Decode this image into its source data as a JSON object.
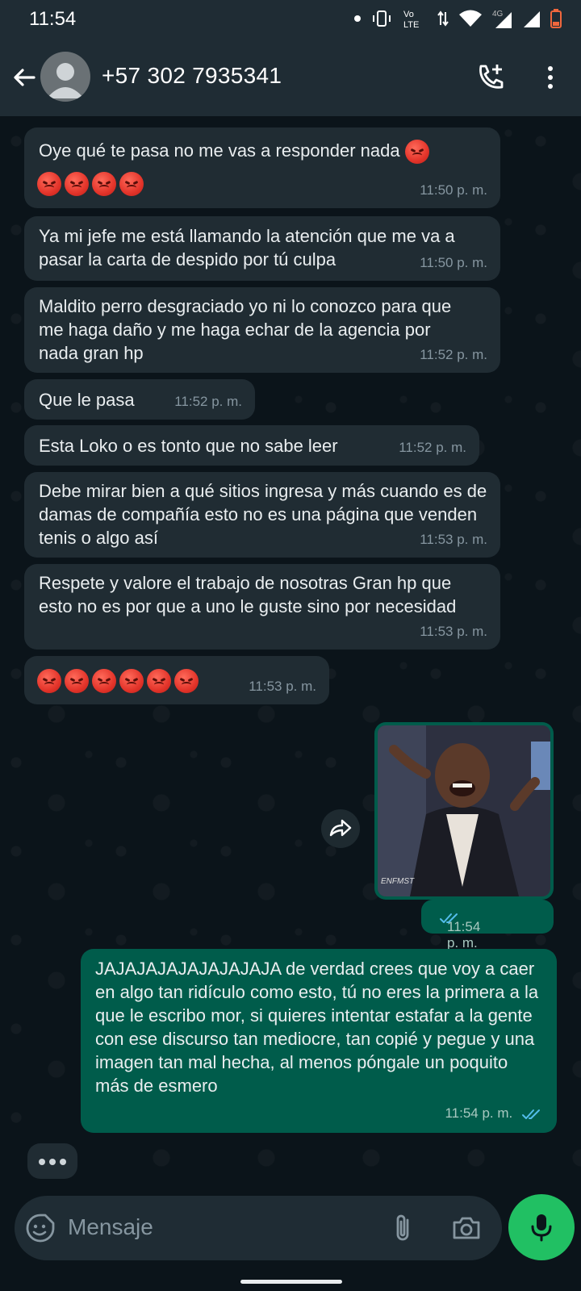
{
  "status_bar": {
    "time": "11:54",
    "network_vo_label": "Vo",
    "network_lte_label": "LTE",
    "network_4g_label": "4G"
  },
  "header": {
    "contact_name": "+57 302 7935341"
  },
  "messages": [
    {
      "direction": "in",
      "text": "Oye qué te pasa no me vas a responder nada",
      "emojis_inline": 1,
      "emojis_next_line": 4,
      "time": "11:50 p. m."
    },
    {
      "direction": "in",
      "text": "Ya mi jefe me está llamando la atención que me va a pasar la carta de despido por tú culpa",
      "time": "11:50 p. m."
    },
    {
      "direction": "in",
      "text": "Maldito perro desgraciado yo ni lo conozco para que me haga daño y me haga echar de la agencia por nada gran hp",
      "time": "11:52 p. m."
    },
    {
      "direction": "in",
      "text": "Que le pasa",
      "time": "11:52 p. m."
    },
    {
      "direction": "in",
      "text": "Esta Loko o es tonto que no sabe leer",
      "time": "11:52 p. m."
    },
    {
      "direction": "in",
      "text": "Debe mirar bien a qué sitios ingresa y más cuando es de damas de compañía esto no es una página que venden tenis o algo así",
      "time": "11:53 p. m."
    },
    {
      "direction": "in",
      "text": "Respete y valore el trabajo de nosotras Gran hp que esto no es por que a uno le guste sino por necesidad",
      "time": "11:53 p. m."
    },
    {
      "direction": "in",
      "text": "",
      "emojis_inline": 6,
      "time": "11:53 p. m."
    },
    {
      "direction": "out",
      "type": "image",
      "image_caption_text": "ENFMST",
      "time": "11:54 p. m.",
      "status": "read"
    },
    {
      "direction": "out",
      "text": "JAJAJAJAJAJAJAJAJA de verdad crees que voy a caer en algo tan ridículo como esto, tú no eres la primera a la que le escribo mor, si quieres intentar estafar a la gente con ese discurso tan mediocre, tan copié y pegue y una imagen tan mal hecha, al menos póngale un poquito más de esmero",
      "time": "11:54 p. m.",
      "status": "read"
    }
  ],
  "composer": {
    "placeholder": "Mensaje"
  },
  "colors": {
    "incoming_bubble": "#202c33",
    "outgoing_bubble": "#005c4b",
    "header": "#1f2c34",
    "read_tick": "#53bdeb",
    "mic_button": "#21c063"
  }
}
